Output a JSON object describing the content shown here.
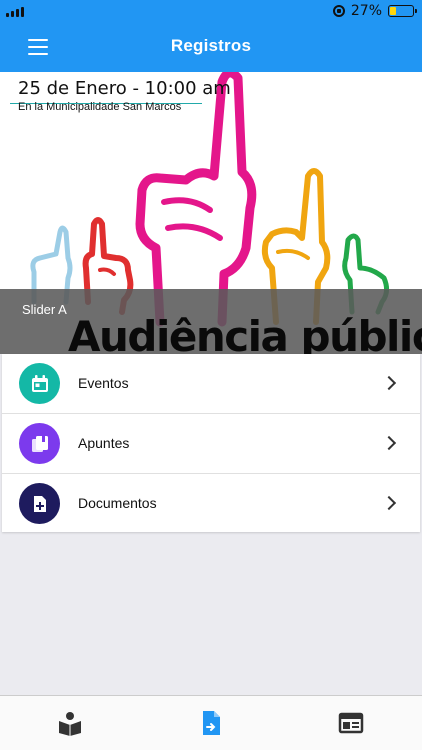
{
  "status": {
    "battery_text": "27%",
    "battery_level": 0.27,
    "battery_color": "#ffd60a"
  },
  "app_bar": {
    "title": "Registros",
    "menu_icon": "hamburger-icon",
    "color": "#2196f3"
  },
  "slider": {
    "date_text": "25 de Enero - 10:00 am",
    "place_text": "En la Municipalidade San Marcos",
    "caption": "Slider A",
    "banner_text": "Audiência pública"
  },
  "menu": [
    {
      "label": "Eventos",
      "icon": "calendar-icon",
      "color": "#14b8a6"
    },
    {
      "label": "Apuntes",
      "icon": "notes-icon",
      "color": "#7c3aed"
    },
    {
      "label": "Documentos",
      "icon": "document-add-icon",
      "color": "#1e1b5e"
    }
  ],
  "tabs": [
    {
      "icon": "book-reader-icon",
      "active": false
    },
    {
      "icon": "document-arrow-icon",
      "active": true
    },
    {
      "icon": "newspaper-icon",
      "active": false
    }
  ]
}
